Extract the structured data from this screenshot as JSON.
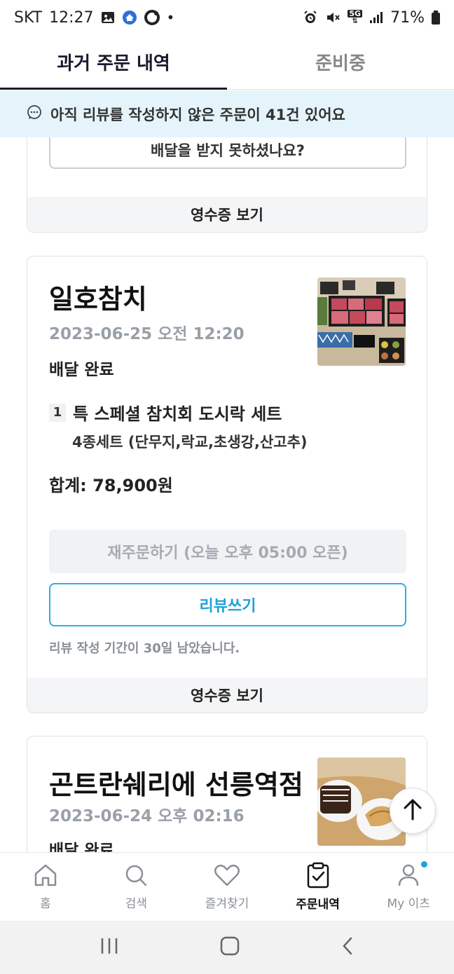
{
  "status_bar": {
    "carrier": "SKT",
    "time": "12:27",
    "battery": "71%",
    "network": "5G"
  },
  "tabs": [
    {
      "label": "과거 주문 내역",
      "active": true
    },
    {
      "label": "준비중",
      "active": false
    }
  ],
  "banner": {
    "text": "아직 리뷰를 작성하지 않은 주문이 41건 있어요"
  },
  "orders": [
    {
      "help_button": "배달을 받지 못하셨나요?",
      "receipt_label": "영수증 보기"
    },
    {
      "store": "일호참치",
      "date": "2023-06-25 오전 12:20",
      "status": "배달 완료",
      "item_qty": "1",
      "item_name": "특 스페셜 참치회 도시락 세트",
      "item_option": "4종세트 (단무지,락교,초생강,산고추)",
      "total": "합계: 78,900원",
      "reorder_label": "재주문하기 (오늘 오후 05:00 오픈)",
      "review_label": "리뷰쓰기",
      "review_note": "리뷰 작성 기간이 30일 남았습니다.",
      "receipt_label": "영수증 보기"
    },
    {
      "store": "곤트란쉐리에 선릉역점",
      "date": "2023-06-24 오후 02:16",
      "status": "배달 완료"
    }
  ],
  "bottom_nav": [
    {
      "label": "홈",
      "icon": "home-icon"
    },
    {
      "label": "검색",
      "icon": "search-icon"
    },
    {
      "label": "즐겨찾기",
      "icon": "heart-icon"
    },
    {
      "label": "주문내역",
      "icon": "clipboard-check-icon",
      "active": true
    },
    {
      "label": "My 이츠",
      "icon": "person-icon"
    }
  ],
  "colors": {
    "accent": "#1da1d6",
    "banner_bg": "#e5f4fb",
    "tab_active": "#1a1a2e"
  }
}
